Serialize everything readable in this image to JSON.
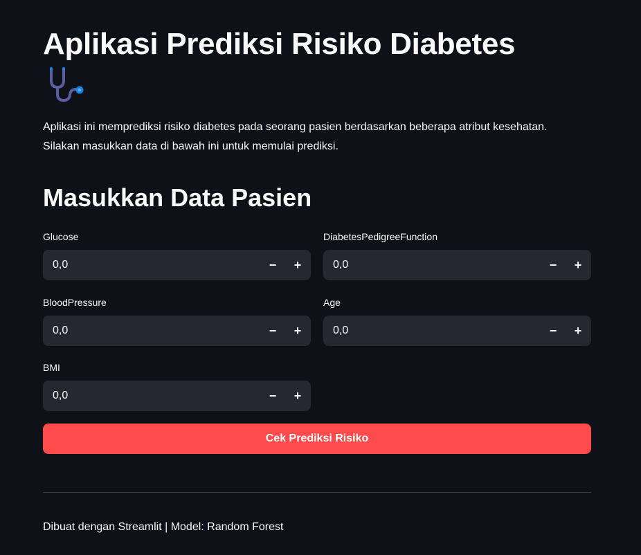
{
  "header": {
    "title": "Aplikasi Prediksi Risiko Diabetes",
    "icon": "stethoscope-icon"
  },
  "description": {
    "line1": "Aplikasi ini memprediksi risiko diabetes pada seorang pasien berdasarkan beberapa atribut kesehatan.",
    "line2": "Silakan masukkan data di bawah ini untuk memulai prediksi."
  },
  "form": {
    "heading": "Masukkan Data Pasien",
    "fields": {
      "glucose": {
        "label": "Glucose",
        "value": "0,0"
      },
      "diabetes_pedigree_function": {
        "label": "DiabetesPedigreeFunction",
        "value": "0,0"
      },
      "blood_pressure": {
        "label": "BloodPressure",
        "value": "0,0"
      },
      "age": {
        "label": "Age",
        "value": "0,0"
      },
      "bmi": {
        "label": "BMI",
        "value": "0,0"
      }
    },
    "stepper": {
      "minus": "−",
      "plus": "+"
    },
    "submit_label": "Cek Prediksi Risiko"
  },
  "footer": {
    "text": "Dibuat dengan Streamlit | Model: Random Forest"
  },
  "colors": {
    "background": "#0e1117",
    "input_background": "#262730",
    "primary_button": "#ff4b4b",
    "text": "#fafafa",
    "icon_blue": "#1c83e1",
    "icon_purple": "#5b5da0"
  }
}
